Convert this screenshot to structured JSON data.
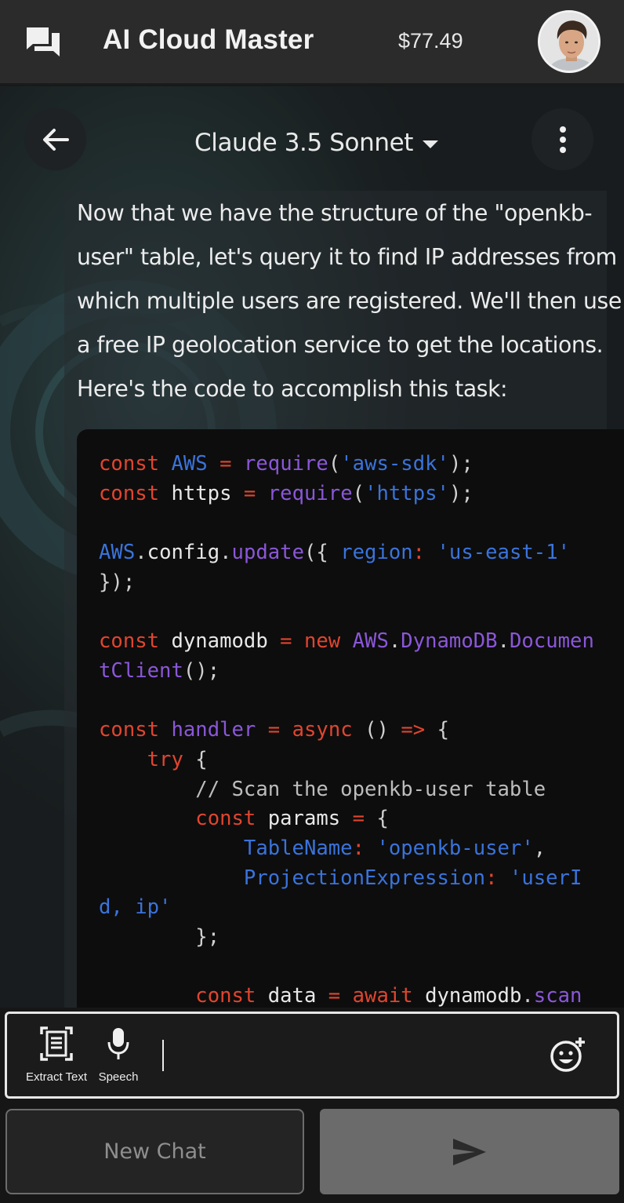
{
  "header": {
    "app_title": "AI Cloud Master",
    "balance": "$77.49",
    "icons": {
      "chat": "chat-bubbles-icon",
      "avatar": "user-avatar"
    }
  },
  "model_bar": {
    "model_name": "Claude 3.5 Sonnet",
    "icons": {
      "back": "arrow-left-icon",
      "more": "more-vertical-icon",
      "dropdown": "caret-down-icon"
    }
  },
  "message": {
    "lines": [
      "Now that we have the structure of the \"openkb-",
      "user\" table, let's query it to find IP addresses from",
      "which multiple users are registered. We'll then use",
      "a free IP geolocation service to get the locations.",
      "Here's the code to accomplish this task:"
    ]
  },
  "code": {
    "lines": [
      [
        [
          "kw",
          "const"
        ],
        [
          "id",
          " "
        ],
        [
          "cls",
          "AWS"
        ],
        [
          "id",
          " "
        ],
        [
          "op",
          "="
        ],
        [
          "id",
          " "
        ],
        [
          "fn",
          "require"
        ],
        [
          "pun",
          "("
        ],
        [
          "str",
          "'aws-sdk'"
        ],
        [
          "pun",
          ");"
        ]
      ],
      [
        [
          "kw",
          "const"
        ],
        [
          "id",
          " https "
        ],
        [
          "op",
          "="
        ],
        [
          "id",
          " "
        ],
        [
          "fn",
          "require"
        ],
        [
          "pun",
          "("
        ],
        [
          "str",
          "'https'"
        ],
        [
          "pun",
          ");"
        ]
      ],
      [],
      [
        [
          "cls",
          "AWS"
        ],
        [
          "pun",
          "."
        ],
        [
          "id",
          "config"
        ],
        [
          "pun",
          "."
        ],
        [
          "fn",
          "update"
        ],
        [
          "pun",
          "({ "
        ],
        [
          "cls",
          "region"
        ],
        [
          "op",
          ":"
        ],
        [
          "id",
          " "
        ],
        [
          "str",
          "'us-east-1'"
        ]
      ],
      [
        [
          "pun",
          "});"
        ]
      ],
      [],
      [
        [
          "kw",
          "const"
        ],
        [
          "id",
          " dynamodb "
        ],
        [
          "op",
          "="
        ],
        [
          "id",
          " "
        ],
        [
          "kw",
          "new"
        ],
        [
          "id",
          " "
        ],
        [
          "fn",
          "AWS"
        ],
        [
          "pun",
          "."
        ],
        [
          "fn",
          "DynamoDB"
        ],
        [
          "pun",
          "."
        ],
        [
          "fn",
          "Documen"
        ]
      ],
      [
        [
          "fn",
          "tClient"
        ],
        [
          "pun",
          "();"
        ]
      ],
      [],
      [
        [
          "kw",
          "const"
        ],
        [
          "id",
          " "
        ],
        [
          "fn",
          "handler"
        ],
        [
          "id",
          " "
        ],
        [
          "op",
          "="
        ],
        [
          "id",
          " "
        ],
        [
          "kw",
          "async"
        ],
        [
          "id",
          " "
        ],
        [
          "pun",
          "()"
        ],
        [
          "id",
          " "
        ],
        [
          "op",
          "=>"
        ],
        [
          "id",
          " "
        ],
        [
          "pun",
          "{"
        ]
      ],
      [
        [
          "id",
          "    "
        ],
        [
          "kw",
          "try"
        ],
        [
          "id",
          " "
        ],
        [
          "pun",
          "{"
        ]
      ],
      [
        [
          "id",
          "        "
        ],
        [
          "com",
          "// Scan the openkb-user table"
        ]
      ],
      [
        [
          "id",
          "        "
        ],
        [
          "kw",
          "const"
        ],
        [
          "id",
          " params "
        ],
        [
          "op",
          "="
        ],
        [
          "id",
          " "
        ],
        [
          "pun",
          "{"
        ]
      ],
      [
        [
          "id",
          "            "
        ],
        [
          "cls",
          "TableName"
        ],
        [
          "op",
          ":"
        ],
        [
          "id",
          " "
        ],
        [
          "str",
          "'openkb-user'"
        ],
        [
          "pun",
          ","
        ]
      ],
      [
        [
          "id",
          "            "
        ],
        [
          "cls",
          "ProjectionExpression"
        ],
        [
          "op",
          ":"
        ],
        [
          "id",
          " "
        ],
        [
          "str",
          "'userI"
        ]
      ],
      [
        [
          "str",
          "d, ip'"
        ]
      ],
      [
        [
          "id",
          "        "
        ],
        [
          "pun",
          "};"
        ]
      ],
      [],
      [
        [
          "id",
          "        "
        ],
        [
          "kw",
          "const"
        ],
        [
          "id",
          " data "
        ],
        [
          "op",
          "="
        ],
        [
          "id",
          " "
        ],
        [
          "kw",
          "await"
        ],
        [
          "id",
          " dynamodb"
        ],
        [
          "pun",
          "."
        ],
        [
          "fn",
          "scan"
        ]
      ]
    ]
  },
  "input": {
    "tools": [
      {
        "label": "Extract Text",
        "icon": "document-scan-icon"
      },
      {
        "label": "Speech",
        "icon": "microphone-icon"
      }
    ],
    "value": "",
    "emoji_icon": "emoji-add-icon"
  },
  "actions": {
    "new_chat_label": "New Chat",
    "send_icon": "send-icon"
  }
}
